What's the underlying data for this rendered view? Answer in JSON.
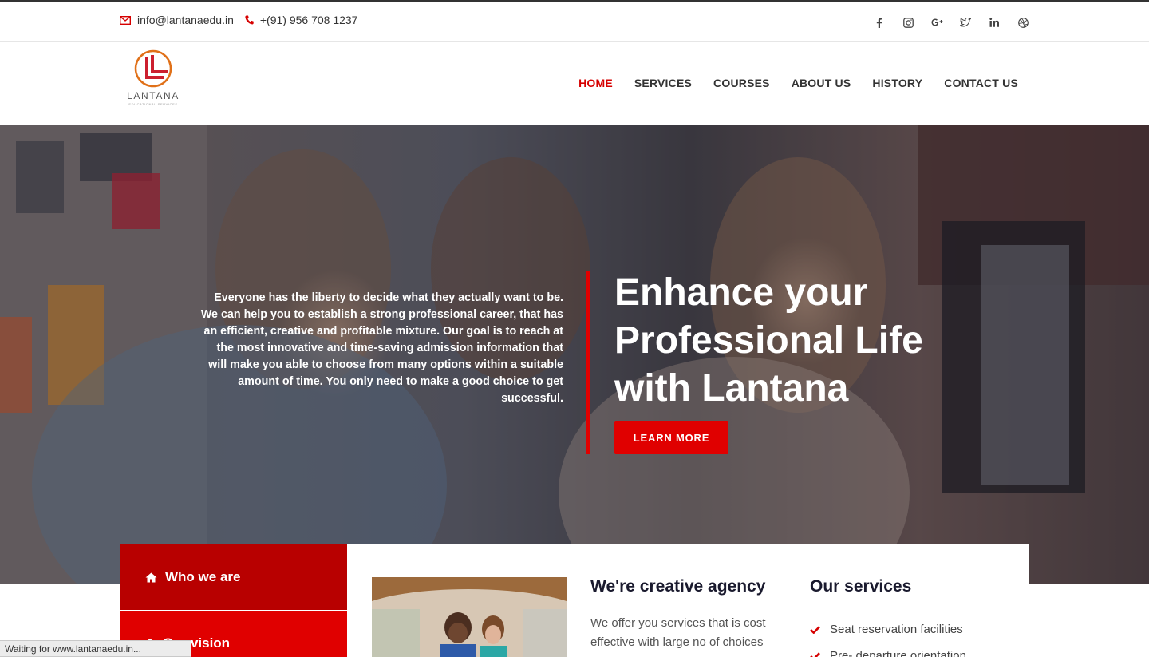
{
  "topbar": {
    "email": "info@lantanaedu.in",
    "phone": "+(91) 956 708 1237",
    "socials": [
      "facebook-icon",
      "instagram-icon",
      "google-plus-icon",
      "twitter-icon",
      "linkedin-icon",
      "dribbble-icon"
    ]
  },
  "logo": {
    "word": "LANTANA",
    "tagline": "EDUCATIONAL SERVICES"
  },
  "nav": {
    "items": [
      {
        "label": "HOME",
        "active": true
      },
      {
        "label": "SERVICES"
      },
      {
        "label": "COURSES"
      },
      {
        "label": "ABOUT US"
      },
      {
        "label": "HISTORY"
      },
      {
        "label": "CONTACT US"
      }
    ]
  },
  "hero": {
    "text": "Everyone has the liberty to decide what they actually want to be. We can help you to establish a strong professional career, that has an efficient, creative and profitable mixture. Our goal is to reach at the most innovative and time-saving admission information that will make you able to choose from many options within a suitable amount of time. You only need to make a good choice to get successful.",
    "title": "Enhance your Professional Life with Lantana",
    "button": "LEARN MORE"
  },
  "tabs": [
    {
      "label": "Who we are",
      "icon": "home-icon"
    },
    {
      "label": "Our vision",
      "icon": "user-icon"
    }
  ],
  "agency": {
    "title": "We're creative agency",
    "text": "We offer you services that is cost effective with large no of choices"
  },
  "services": {
    "title": "Our services",
    "items": [
      "Seat reservation facilities",
      "Pre- departure orientation"
    ]
  },
  "status": "Waiting for www.lantanaedu.in...",
  "colors": {
    "accent": "#e00000",
    "dark_tab": "#b80000"
  }
}
